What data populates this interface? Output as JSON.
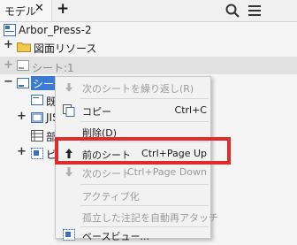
{
  "header": {
    "tab_label": "モデル",
    "close_glyph": "✕",
    "add_glyph": "+"
  },
  "tree": {
    "root": "Arbor_Press-2",
    "sheet_format": "図面リソース",
    "sheet1": "シート:1",
    "sheet2": "シート",
    "child_a": "既",
    "child_b": "JIS",
    "child_c": "部",
    "child_d": "ビ",
    "expand_glyph": "+",
    "collapse_glyph": "−"
  },
  "context_menu": {
    "items": [
      {
        "label": "次のシートを繰り返し(R)",
        "shortcut": "",
        "enabled": false
      },
      {
        "label": "コピー",
        "shortcut": "Ctrl+C",
        "enabled": true
      },
      {
        "label": "削除(D)",
        "shortcut": "",
        "enabled": true
      },
      {
        "label": "前のシート",
        "shortcut": "Ctrl+Page Up",
        "enabled": true
      },
      {
        "label": "次のシート",
        "shortcut": "Ctrl+Page Down",
        "enabled": false
      },
      {
        "label": "アクティブ化",
        "shortcut": "",
        "enabled": false
      },
      {
        "label": "孤立した注記を自動再アタッチ",
        "shortcut": "",
        "enabled": false
      },
      {
        "label": "ベースビュー...",
        "shortcut": "",
        "enabled": true
      }
    ]
  },
  "colors": {
    "highlight": "#e02b2b",
    "selection": "#3a7bd5",
    "folder": "#f2c94c"
  }
}
